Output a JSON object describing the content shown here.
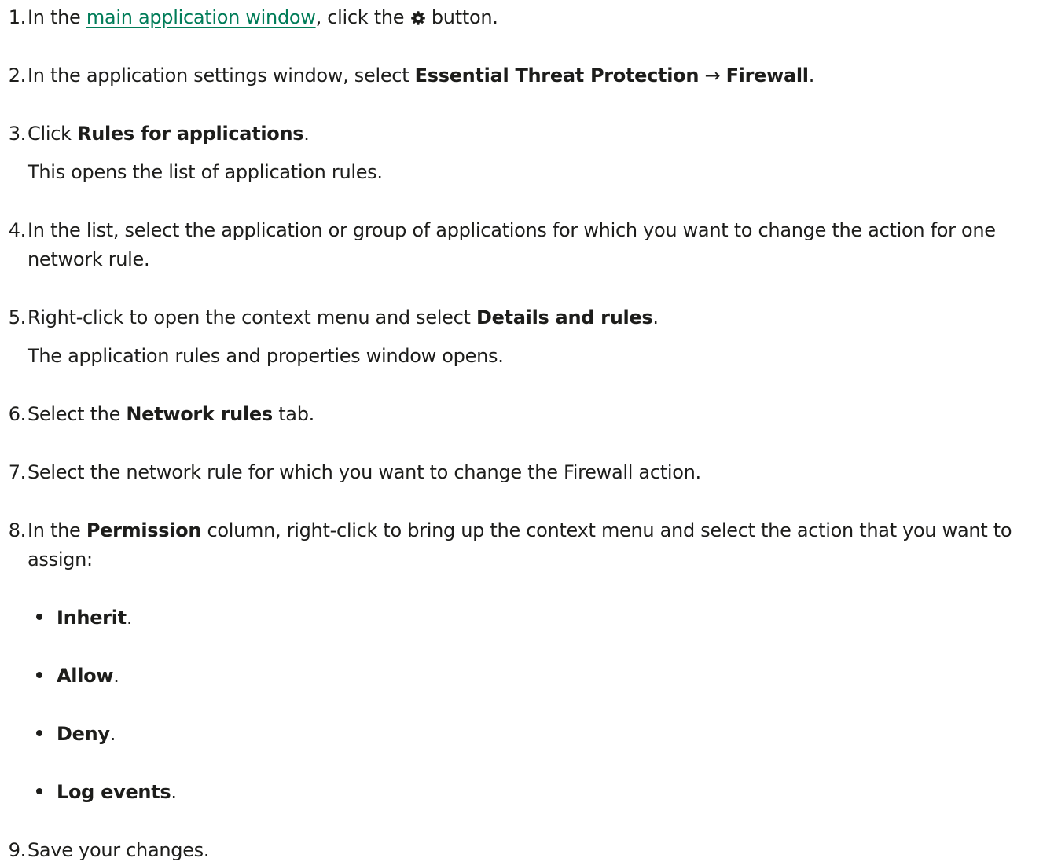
{
  "steps": [
    {
      "num": "1.",
      "pre": "In the ",
      "link": "main application window",
      "mid": ", click the ",
      "icon": "gear-icon",
      "post": " button."
    },
    {
      "num": "2.",
      "pre": "In the application settings window, select ",
      "bold1": "Essential Threat Protection",
      "arrow": " → ",
      "bold2": "Firewall",
      "post": "."
    },
    {
      "num": "3.",
      "pre": "Click ",
      "bold": "Rules for applications",
      "post": ".",
      "note": "This opens the list of application rules."
    },
    {
      "num": "4.",
      "line1": "In the list, select the application or group of applications for which you want to change the action for one",
      "line2": "network rule."
    },
    {
      "num": "5.",
      "pre": "Right-click to open the context menu and select ",
      "bold": "Details and rules",
      "post": ".",
      "note": "The application rules and properties window opens."
    },
    {
      "num": "6.",
      "pre": "Select the ",
      "bold": "Network rules",
      "post": " tab."
    },
    {
      "num": "7.",
      "text": "Select the network rule for which you want to change the Firewall action."
    },
    {
      "num": "8.",
      "pre": "In the ",
      "bold": "Permission",
      "post": " column, right-click to bring up the context menu and select the action that you want to",
      "line2": "assign:",
      "options": [
        {
          "label": "Inherit",
          "punct": "."
        },
        {
          "label": "Allow",
          "punct": "."
        },
        {
          "label": "Deny",
          "punct": "."
        },
        {
          "label": "Log events",
          "punct": "."
        }
      ]
    },
    {
      "num": "9.",
      "text": "Save your changes."
    }
  ],
  "colors": {
    "text": "#1d1d1b",
    "link": "#007c58"
  }
}
